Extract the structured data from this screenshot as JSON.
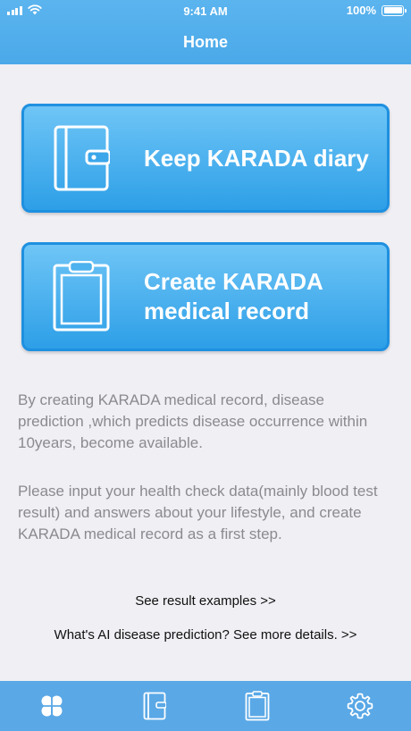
{
  "status_bar": {
    "time": "9:41 AM",
    "battery": "100%"
  },
  "nav": {
    "title": "Home"
  },
  "buttons": {
    "diary_label_line1": "Keep KARADA diary",
    "record_label_line1": "Create KARADA",
    "record_label_line2": "medical record"
  },
  "description": {
    "paragraph1": "By creating KARADA medical record, disease prediction ,which predicts disease occurrence within 10years, become available.",
    "paragraph2": "Please input your health check data(mainly blood test result) and answers about your lifestyle, and create KARADA medical record as a first step."
  },
  "links": {
    "examples": "See result examples >>",
    "ai_details": "What's AI disease prediction? See more details. >>"
  },
  "tabbar": {
    "items": [
      {
        "icon": "clover-icon",
        "active": true
      },
      {
        "icon": "diary-icon",
        "active": false
      },
      {
        "icon": "clipboard-icon",
        "active": false
      },
      {
        "icon": "gear-icon",
        "active": false
      }
    ]
  },
  "colors": {
    "header": "#4ba9e9",
    "button_top": "#6fc5f6",
    "button_bottom": "#2d9fe7",
    "tabbar": "#5aa8e6",
    "background": "#efeff4",
    "description_text": "#8a8a8f"
  }
}
